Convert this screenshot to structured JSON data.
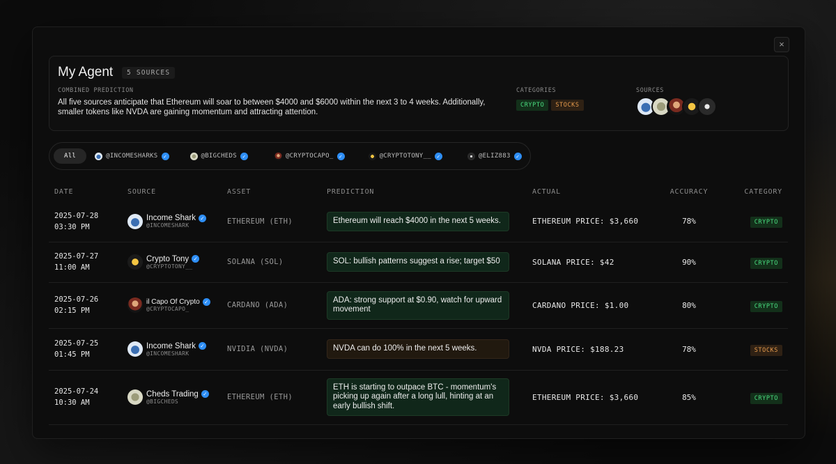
{
  "modal": {
    "close_glyph": "×",
    "title": "My Agent",
    "sources_badge": "5 SOURCES",
    "combined_label": "COMBINED PREDICTION",
    "combined_text": "All five sources anticipate that Ethereum will soar to between $4000 and $6000 within the next 3 to 4 weeks. Additionally, smaller tokens like NVDA are gaining momentum and attracting attention.",
    "categories_label": "CATEGORIES",
    "categories": [
      "CRYPTO",
      "STOCKS"
    ],
    "sources_label": "SOURCES"
  },
  "filters": {
    "all": "All",
    "chips": [
      {
        "handle": "@INCOMESHARKS",
        "icon": "income-shark-avatar"
      },
      {
        "handle": "@BIGCHEDS",
        "icon": "cheds-avatar"
      },
      {
        "handle": "@CRYPTOCAPO_",
        "icon": "capo-avatar"
      },
      {
        "handle": "@CRYPTOTONY__",
        "icon": "tony-avatar"
      },
      {
        "handle": "@ELIZ883",
        "icon": "eliz-avatar"
      }
    ]
  },
  "table": {
    "headers": {
      "date": "DATE",
      "source": "SOURCE",
      "asset": "ASSET",
      "prediction": "PREDICTION",
      "actual": "ACTUAL",
      "accuracy": "ACCURACY",
      "category": "CATEGORY"
    },
    "rows": [
      {
        "date": "2025-07-28",
        "time": "03:30 PM",
        "name": "Income Shark",
        "handle": "@INCOMESHARK",
        "asset": "ETHEREUM (ETH)",
        "prediction": "Ethereum will reach $4000 in the next 5 weeks.",
        "actual": "ETHEREUM PRICE: $3,660",
        "accuracy": "78%",
        "category": "CRYPTO"
      },
      {
        "date": "2025-07-27",
        "time": "11:00 AM",
        "name": "Crypto Tony",
        "handle": "@CRYPTOTONY__",
        "asset": "SOLANA (SOL)",
        "prediction": "SOL: bullish patterns suggest a rise; target $50",
        "actual": "SOLANA PRICE: $42",
        "accuracy": "90%",
        "category": "CRYPTO"
      },
      {
        "date": "2025-07-26",
        "time": "02:15 PM",
        "name": "il Capo Of Crypto",
        "handle": "@CRYPTOCAPO_",
        "asset": "CARDANO (ADA)",
        "prediction": "ADA: strong support at $0.90, watch for upward movement",
        "actual": "CARDANO PRICE: $1.00",
        "accuracy": "80%",
        "category": "CRYPTO"
      },
      {
        "date": "2025-07-25",
        "time": "01:45 PM",
        "name": "Income Shark",
        "handle": "@INCOMESHARK",
        "asset": "NVIDIA (NVDA)",
        "prediction": "NVDA can do 100% in the next 5 weeks.",
        "actual": "NVDA PRICE: $188.23",
        "accuracy": "78%",
        "category": "STOCKS"
      },
      {
        "date": "2025-07-24",
        "time": "10:30 AM",
        "name": "Cheds Trading",
        "handle": "@BIGCHEDS",
        "asset": "ETHEREUM (ETH)",
        "prediction": "ETH is starting to outpace BTC - momentum's picking up again after a long lull, hinting at an early bullish shift.",
        "actual": "ETHEREUM PRICE: $3,660",
        "accuracy": "85%",
        "category": "CRYPTO"
      }
    ]
  },
  "colors": {
    "crypto": "#4ade80",
    "stocks": "#e59a4c",
    "verified": "#2e8ef5"
  }
}
